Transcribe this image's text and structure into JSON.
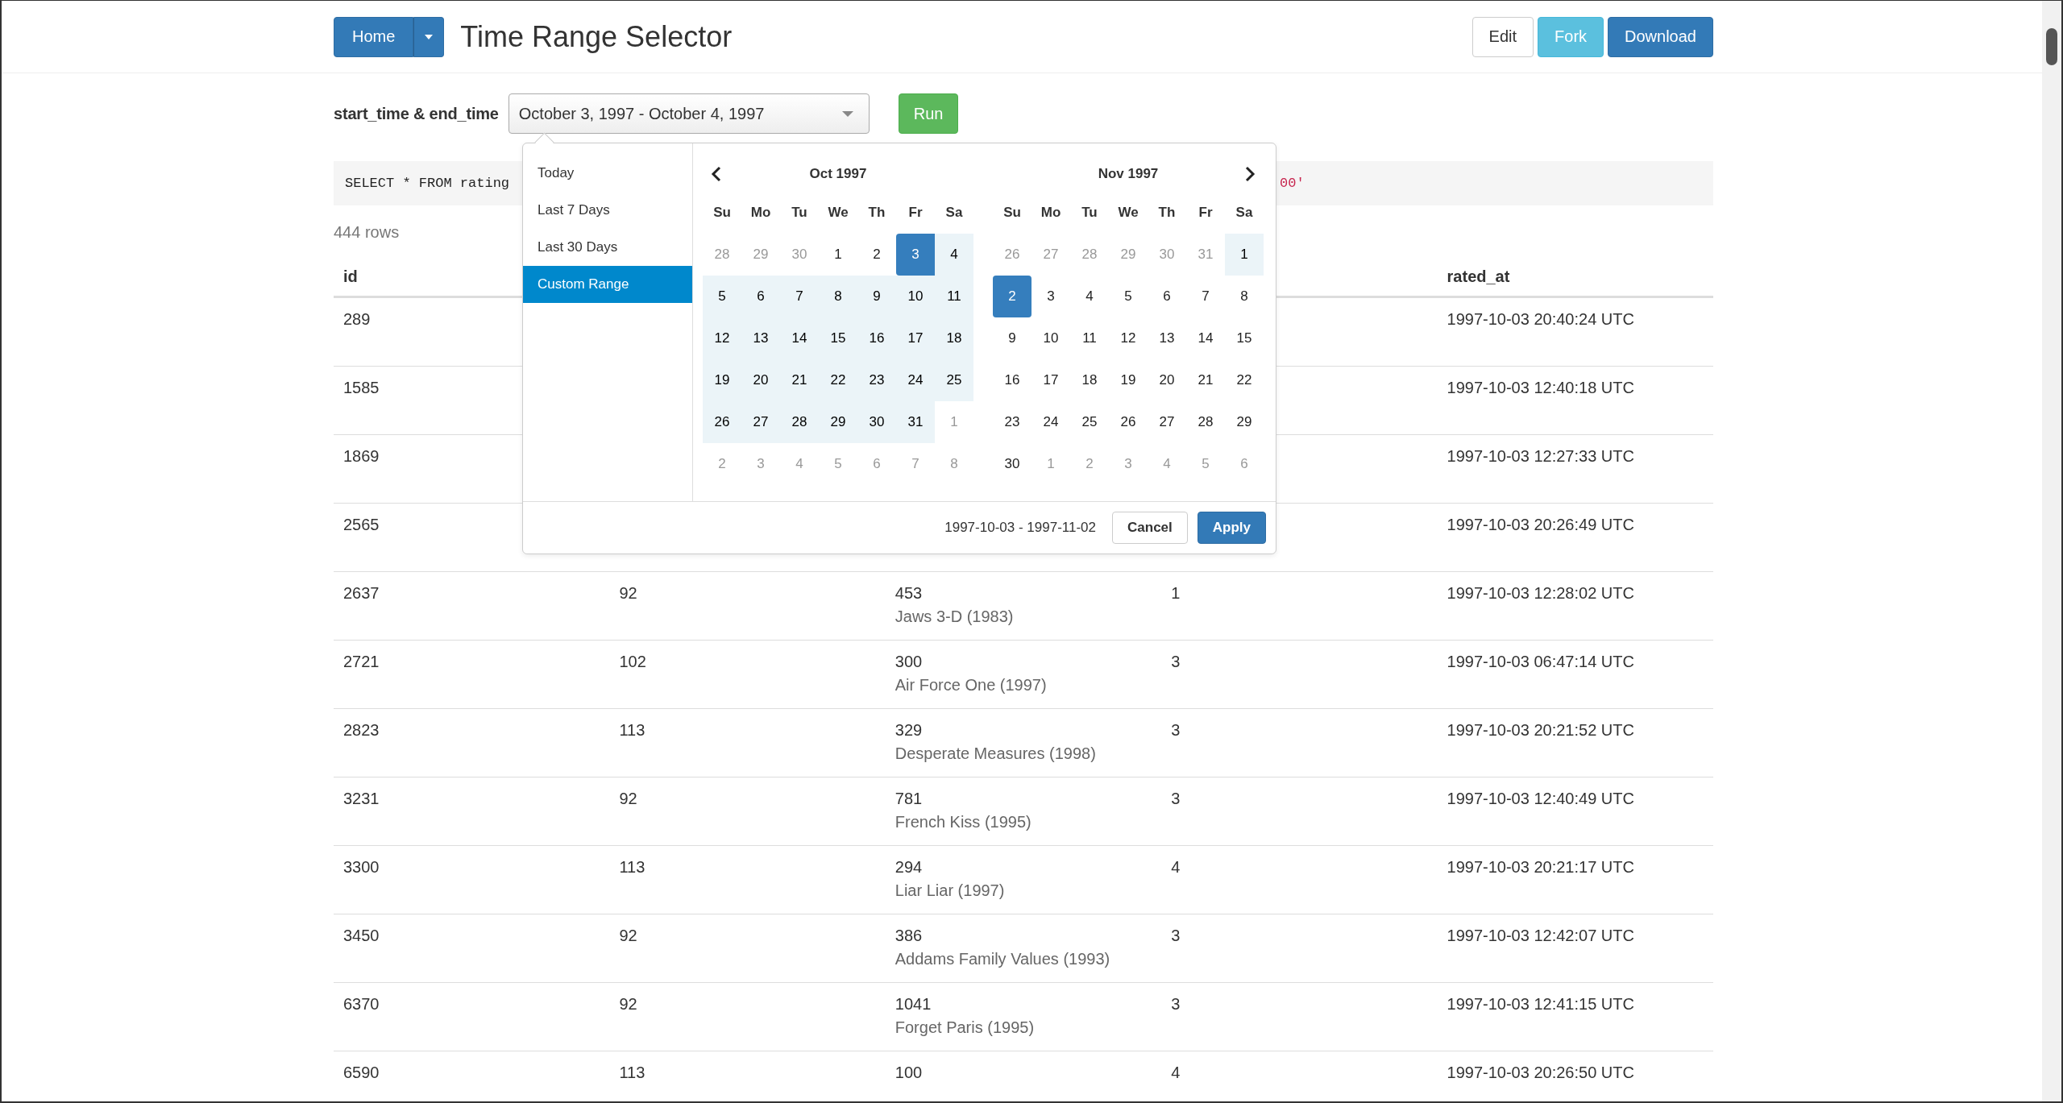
{
  "navbar": {
    "home_button": "Home",
    "title": "Time Range Selector",
    "actions": [
      {
        "label": "Edit",
        "kind": "default"
      },
      {
        "label": "Fork",
        "kind": "info"
      },
      {
        "label": "Download",
        "kind": "primary"
      }
    ]
  },
  "filter": {
    "label": "start_time & end_time",
    "value": "October 3, 1997 - October 4, 1997",
    "run_button": "Run"
  },
  "query": {
    "start": "SELECT * FROM rating",
    "end": "00'"
  },
  "row_count": "444 rows",
  "table": {
    "columns": [
      {
        "label": "id"
      },
      {},
      {},
      {},
      {
        "label": "rated_at"
      }
    ],
    "rows": [
      {
        "id": "289",
        "rated_at": "1997-10-03 20:40:24 UTC"
      },
      {
        "id": "1585",
        "rated_at": "1997-10-03 12:40:18 UTC"
      },
      {
        "id": "1869",
        "rated_at": "1997-10-03 12:27:33 UTC"
      },
      {
        "id": "2565",
        "rated_at": "1997-10-03 20:26:49 UTC"
      },
      {
        "id": "2637",
        "column_2": "92",
        "movie_id": "453",
        "movie_title": "Jaws 3-D (1983)",
        "column_4": "1",
        "rated_at": "1997-10-03 12:28:02 UTC"
      },
      {
        "id": "2721",
        "column_2": "102",
        "movie_id": "300",
        "movie_title": "Air Force One (1997)",
        "column_4": "3",
        "rated_at": "1997-10-03 06:47:14 UTC"
      },
      {
        "id": "2823",
        "column_2": "113",
        "movie_id": "329",
        "movie_title": "Desperate Measures (1998)",
        "column_4": "3",
        "rated_at": "1997-10-03 20:21:52 UTC"
      },
      {
        "id": "3231",
        "column_2": "92",
        "movie_id": "781",
        "movie_title": "French Kiss (1995)",
        "column_4": "3",
        "rated_at": "1997-10-03 12:40:49 UTC"
      },
      {
        "id": "3300",
        "column_2": "113",
        "movie_id": "294",
        "movie_title": "Liar Liar (1997)",
        "column_4": "4",
        "rated_at": "1997-10-03 20:21:17 UTC"
      },
      {
        "id": "3450",
        "column_2": "92",
        "movie_id": "386",
        "movie_title": "Addams Family Values (1993)",
        "column_4": "3",
        "rated_at": "1997-10-03 12:42:07 UTC"
      },
      {
        "id": "6370",
        "column_2": "92",
        "movie_id": "1041",
        "movie_title": "Forget Paris (1995)",
        "column_4": "3",
        "rated_at": "1997-10-03 12:41:15 UTC"
      },
      {
        "id": "6590",
        "column_2": "113",
        "movie_id": "100",
        "column_4": "4",
        "rated_at": "1997-10-03 20:26:50 UTC"
      }
    ]
  },
  "date_picker": {
    "ranges": [
      {
        "label": "Today",
        "selected": false
      },
      {
        "label": "Last 7 Days",
        "selected": false
      },
      {
        "label": "Last 30 Days",
        "selected": false
      },
      {
        "label": "Custom Range",
        "selected": true
      }
    ],
    "months": [
      {
        "title": "Oct 1997",
        "weekdays": [
          "Su",
          "Mo",
          "Tu",
          "We",
          "Th",
          "Fr",
          "Sa"
        ],
        "weeks": [
          [
            {
              "day": "28",
              "kind": "off"
            },
            {
              "day": "29",
              "kind": "off"
            },
            {
              "day": "30",
              "kind": "off"
            },
            {
              "day": "1",
              "kind": "normal"
            },
            {
              "day": "2",
              "kind": "normal"
            },
            {
              "day": "3",
              "kind": "start"
            },
            {
              "day": "4",
              "kind": "range"
            }
          ],
          [
            {
              "day": "5",
              "kind": "range"
            },
            {
              "day": "6",
              "kind": "range"
            },
            {
              "day": "7",
              "kind": "range"
            },
            {
              "day": "8",
              "kind": "range"
            },
            {
              "day": "9",
              "kind": "range"
            },
            {
              "day": "10",
              "kind": "range"
            },
            {
              "day": "11",
              "kind": "range"
            }
          ],
          [
            {
              "day": "12",
              "kind": "range"
            },
            {
              "day": "13",
              "kind": "range"
            },
            {
              "day": "14",
              "kind": "range"
            },
            {
              "day": "15",
              "kind": "range"
            },
            {
              "day": "16",
              "kind": "range"
            },
            {
              "day": "17",
              "kind": "range"
            },
            {
              "day": "18",
              "kind": "range"
            }
          ],
          [
            {
              "day": "19",
              "kind": "range"
            },
            {
              "day": "20",
              "kind": "range"
            },
            {
              "day": "21",
              "kind": "range"
            },
            {
              "day": "22",
              "kind": "range"
            },
            {
              "day": "23",
              "kind": "range"
            },
            {
              "day": "24",
              "kind": "range"
            },
            {
              "day": "25",
              "kind": "range"
            }
          ],
          [
            {
              "day": "26",
              "kind": "range"
            },
            {
              "day": "27",
              "kind": "range"
            },
            {
              "day": "28",
              "kind": "range"
            },
            {
              "day": "29",
              "kind": "range"
            },
            {
              "day": "30",
              "kind": "range"
            },
            {
              "day": "31",
              "kind": "range"
            },
            {
              "day": "1",
              "kind": "off"
            }
          ],
          [
            {
              "day": "2",
              "kind": "off"
            },
            {
              "day": "3",
              "kind": "off"
            },
            {
              "day": "4",
              "kind": "off"
            },
            {
              "day": "5",
              "kind": "off"
            },
            {
              "day": "6",
              "kind": "off"
            },
            {
              "day": "7",
              "kind": "off"
            },
            {
              "day": "8",
              "kind": "off"
            }
          ]
        ]
      },
      {
        "title": "Nov 1997",
        "weekdays": [
          "Su",
          "Mo",
          "Tu",
          "We",
          "Th",
          "Fr",
          "Sa"
        ],
        "weeks": [
          [
            {
              "day": "26",
              "kind": "off"
            },
            {
              "day": "27",
              "kind": "off"
            },
            {
              "day": "28",
              "kind": "off"
            },
            {
              "day": "29",
              "kind": "off"
            },
            {
              "day": "30",
              "kind": "off"
            },
            {
              "day": "31",
              "kind": "off"
            },
            {
              "day": "1",
              "kind": "range"
            }
          ],
          [
            {
              "day": "2",
              "kind": "end"
            },
            {
              "day": "3",
              "kind": "normal"
            },
            {
              "day": "4",
              "kind": "normal"
            },
            {
              "day": "5",
              "kind": "normal"
            },
            {
              "day": "6",
              "kind": "normal"
            },
            {
              "day": "7",
              "kind": "normal"
            },
            {
              "day": "8",
              "kind": "normal"
            }
          ],
          [
            {
              "day": "9",
              "kind": "normal"
            },
            {
              "day": "10",
              "kind": "normal"
            },
            {
              "day": "11",
              "kind": "normal"
            },
            {
              "day": "12",
              "kind": "normal"
            },
            {
              "day": "13",
              "kind": "normal"
            },
            {
              "day": "14",
              "kind": "normal"
            },
            {
              "day": "15",
              "kind": "normal"
            }
          ],
          [
            {
              "day": "16",
              "kind": "normal"
            },
            {
              "day": "17",
              "kind": "normal"
            },
            {
              "day": "18",
              "kind": "normal"
            },
            {
              "day": "19",
              "kind": "normal"
            },
            {
              "day": "20",
              "kind": "normal"
            },
            {
              "day": "21",
              "kind": "normal"
            },
            {
              "day": "22",
              "kind": "normal"
            }
          ],
          [
            {
              "day": "23",
              "kind": "normal"
            },
            {
              "day": "24",
              "kind": "normal"
            },
            {
              "day": "25",
              "kind": "normal"
            },
            {
              "day": "26",
              "kind": "normal"
            },
            {
              "day": "27",
              "kind": "normal"
            },
            {
              "day": "28",
              "kind": "normal"
            },
            {
              "day": "29",
              "kind": "normal"
            }
          ],
          [
            {
              "day": "30",
              "kind": "normal"
            },
            {
              "day": "1",
              "kind": "off"
            },
            {
              "day": "2",
              "kind": "off"
            },
            {
              "day": "3",
              "kind": "off"
            },
            {
              "day": "4",
              "kind": "off"
            },
            {
              "day": "5",
              "kind": "off"
            },
            {
              "day": "6",
              "kind": "off"
            }
          ]
        ]
      }
    ],
    "selection": "1997-10-03 - 1997-11-02",
    "cancel_button": "Cancel",
    "apply_button": "Apply"
  }
}
